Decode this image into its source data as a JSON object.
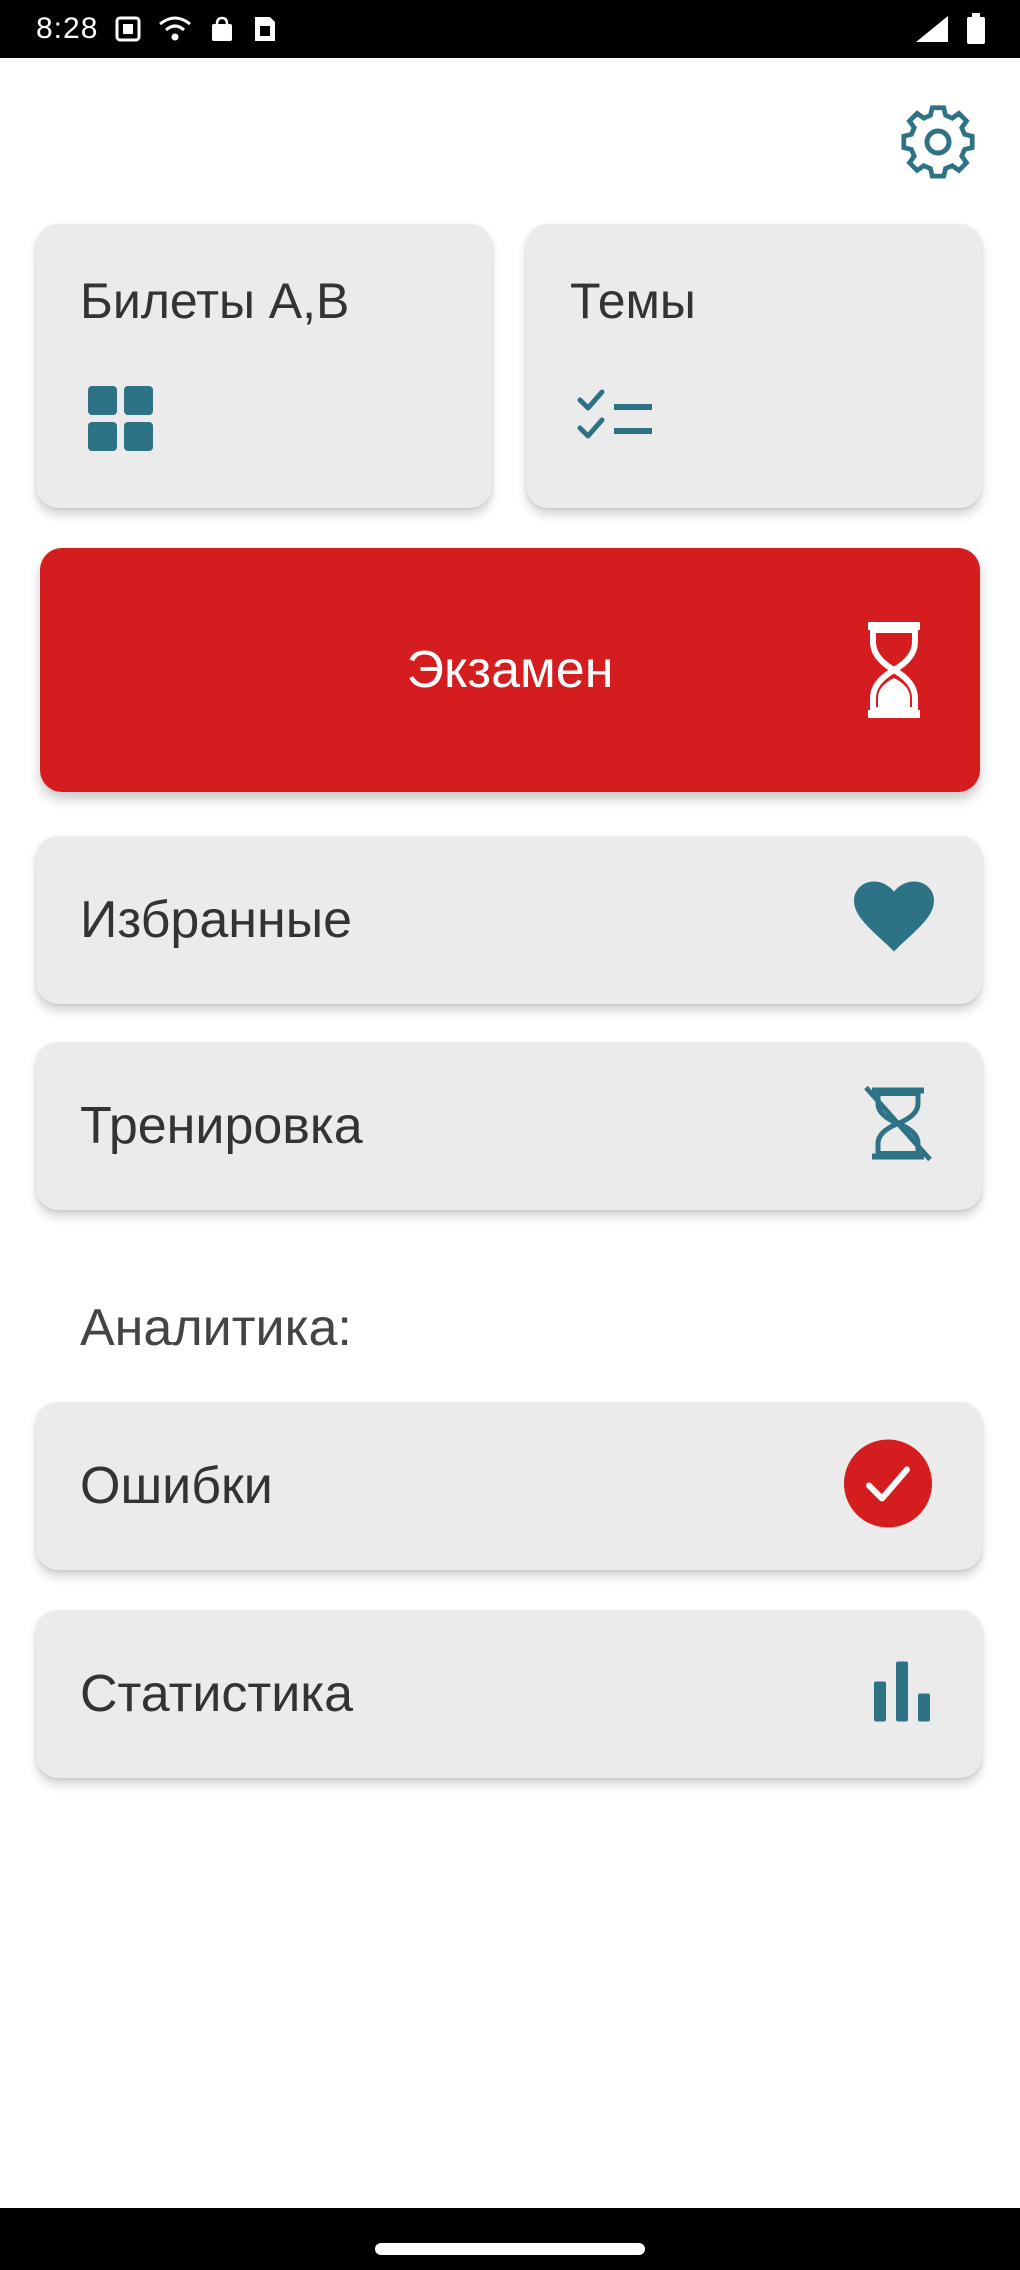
{
  "status_bar": {
    "time": "8:28",
    "left_icons": [
      "screenshot-icon",
      "wifi-icon",
      "bag-icon",
      "sim-icon"
    ],
    "right_icons": [
      "signal-icon",
      "battery-icon"
    ]
  },
  "header": {
    "settings_icon": "gear-icon"
  },
  "tiles": {
    "tickets": {
      "label": "Билеты А,В",
      "icon": "grid-icon"
    },
    "topics": {
      "label": "Темы",
      "icon": "checklist-icon"
    }
  },
  "exam": {
    "label": "Экзамен",
    "icon": "hourglass-icon"
  },
  "menu": {
    "favorites": {
      "label": "Избранные",
      "icon": "heart-icon"
    },
    "training": {
      "label": "Тренировка",
      "icon": "hourglass-disabled-icon"
    }
  },
  "analytics": {
    "section_label": "Аналитика:",
    "errors": {
      "label": "Ошибки",
      "icon": "check-circle-icon"
    },
    "statistics": {
      "label": "Статистика",
      "icon": "bar-chart-icon"
    }
  },
  "colors": {
    "accent": "#2e7385",
    "exam_red": "#d51c1f",
    "card_bg": "#ebebeb",
    "text": "#333333"
  }
}
